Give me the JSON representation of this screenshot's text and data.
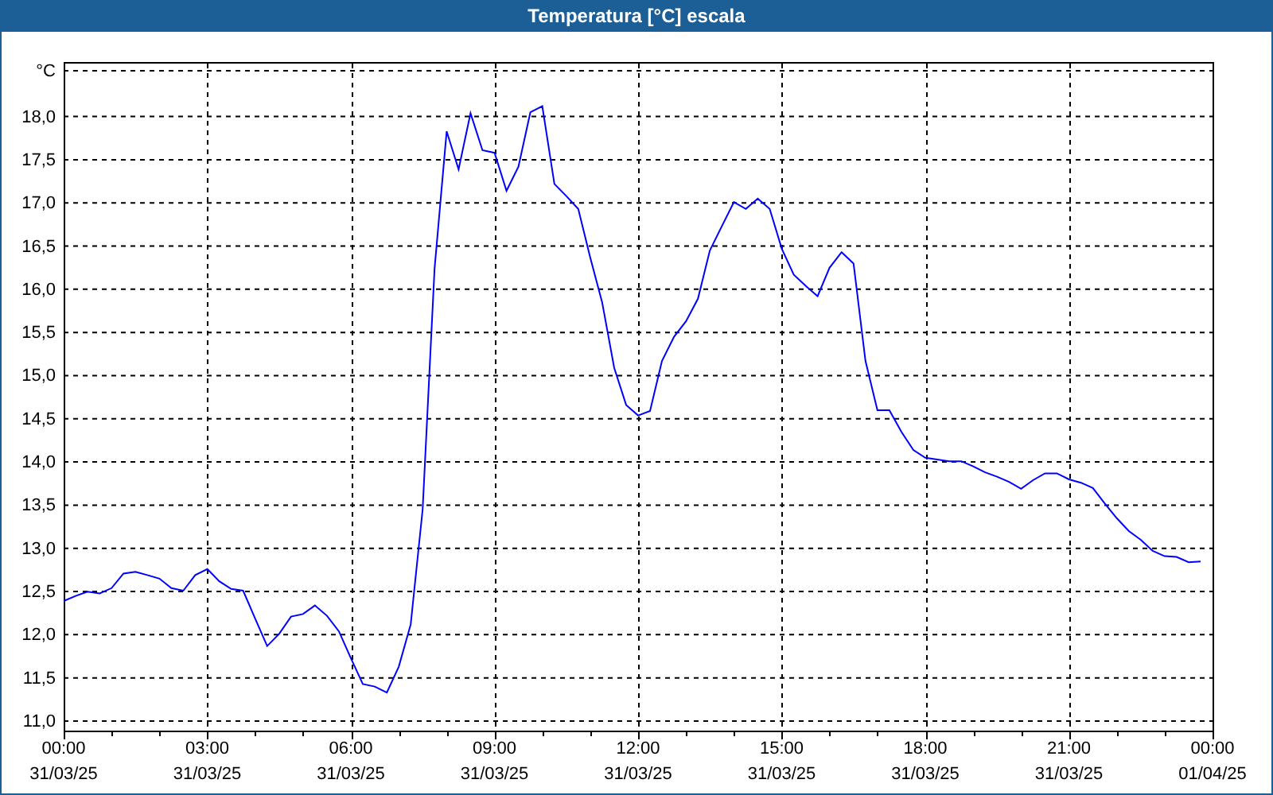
{
  "window": {
    "title": "Temperatura [°C] escala"
  },
  "chart_data": {
    "type": "line",
    "ylabel": "°C",
    "ylim": [
      11,
      18.53
    ],
    "grid": true,
    "yticks": [
      {
        "value": 11,
        "label": "11,0"
      },
      {
        "value": 11.5,
        "label": "11,5"
      },
      {
        "value": 12,
        "label": "12,0"
      },
      {
        "value": 12.5,
        "label": "12,5"
      },
      {
        "value": 13,
        "label": "13,0"
      },
      {
        "value": 13.5,
        "label": "13,5"
      },
      {
        "value": 14,
        "label": "14,0"
      },
      {
        "value": 14.5,
        "label": "14,5"
      },
      {
        "value": 15,
        "label": "15,0"
      },
      {
        "value": 15.5,
        "label": "15,5"
      },
      {
        "value": 16,
        "label": "16,0"
      },
      {
        "value": 16.5,
        "label": "16,5"
      },
      {
        "value": 17,
        "label": "17,0"
      },
      {
        "value": 17.5,
        "label": "17,5"
      },
      {
        "value": 18,
        "label": "18,0"
      }
    ],
    "categories": [
      "00:00 31/03/25",
      null,
      null,
      null,
      null,
      null,
      null,
      null,
      null,
      null,
      null,
      null,
      "03:00 31/03/25",
      null,
      null,
      null,
      null,
      null,
      null,
      null,
      null,
      null,
      null,
      null,
      "06:00 31/03/25",
      null,
      null,
      null,
      null,
      null,
      null,
      null,
      null,
      null,
      null,
      null,
      "09:00 31/03/25",
      null,
      null,
      null,
      null,
      null,
      null,
      null,
      null,
      null,
      null,
      null,
      "12:00 31/03/25",
      null,
      null,
      null,
      null,
      null,
      null,
      null,
      null,
      null,
      null,
      null,
      "15:00 31/03/25",
      null,
      null,
      null,
      null,
      null,
      null,
      null,
      null,
      null,
      null,
      null,
      "18:00 31/03/25",
      null,
      null,
      null,
      null,
      null,
      null,
      null,
      null,
      null,
      null,
      null,
      "21:00 31/03/25",
      null,
      null,
      null,
      null,
      null,
      null,
      null,
      null,
      null,
      null,
      null,
      "00:00 01/04/25"
    ],
    "series": [
      {
        "color": "#0000ff",
        "values": [
          12.38,
          12.44,
          12.49,
          12.47,
          12.53,
          12.7,
          12.72,
          12.68,
          12.64,
          12.53,
          12.5,
          12.68,
          12.75,
          12.61,
          12.52,
          12.5,
          12.18,
          11.86,
          12,
          12.2,
          12.23,
          12.33,
          12.21,
          12.03,
          11.72,
          11.42,
          11.39,
          11.32,
          11.62,
          12.11,
          13.44,
          16.23,
          17.82,
          17.38,
          18.03,
          17.6,
          17.57,
          17.13,
          17.41,
          18.04,
          18.11,
          17.21,
          17.07,
          16.92,
          16.36,
          15.84,
          15.08,
          14.65,
          14.53,
          14.58,
          15.16,
          15.44,
          15.62,
          15.88,
          16.44,
          16.72,
          17,
          16.92,
          17.04,
          16.92,
          16.46,
          16.16,
          16.03,
          15.91,
          16.24,
          16.42,
          16.29,
          15.16,
          14.59,
          14.59,
          14.34,
          14.13,
          14.04,
          14.02,
          14,
          14,
          13.94,
          13.87,
          13.82,
          13.76,
          13.68,
          13.78,
          13.86,
          13.86,
          13.79,
          13.75,
          13.69,
          13.51,
          13.34,
          13.19,
          13.09,
          12.96,
          12.9,
          12.89,
          12.83,
          12.84,
          null
        ]
      }
    ]
  }
}
